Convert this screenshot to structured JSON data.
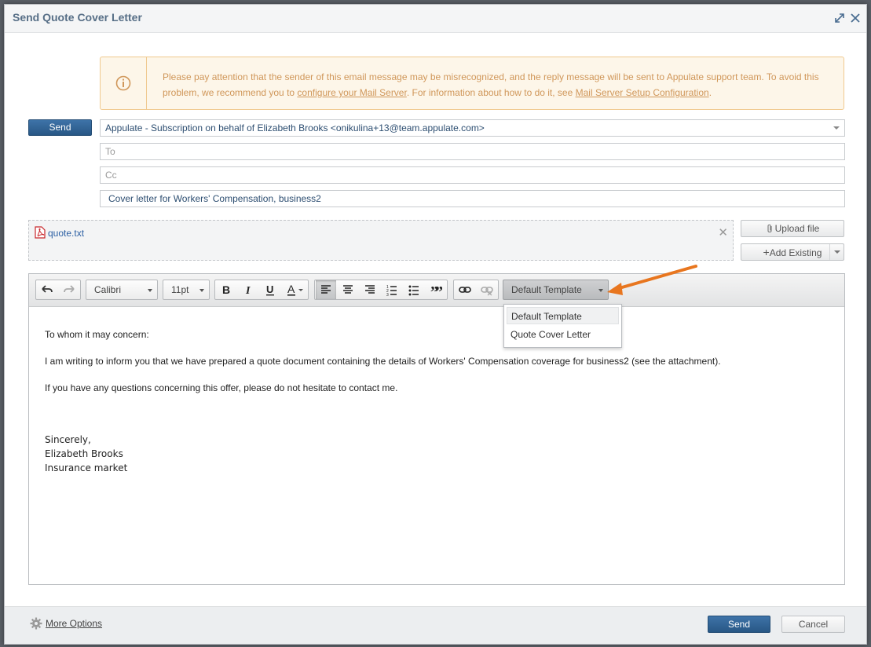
{
  "dialog": {
    "title": "Send Quote Cover Letter"
  },
  "warning": {
    "text_1": "Please pay attention that the sender of this email message may be misrecognized, and the reply message will be sent to Appulate support team. To avoid this problem, we recommend you to ",
    "link_1": "configure your Mail Server",
    "text_2": ". For information about how to do it, see ",
    "link_2": "Mail Server Setup Configuration",
    "text_3": "."
  },
  "compose": {
    "send_label": "Send",
    "from_value": "Appulate - Subscription on behalf of Elizabeth Brooks <onikulina+13@team.appulate.com>",
    "to_placeholder": "To",
    "cc_placeholder": "Cc",
    "subject_value": "Cover letter for Workers' Compensation, business2"
  },
  "attachments": {
    "files": [
      "quote.txt"
    ],
    "upload_label": "Upload file",
    "add_existing_label": "Add Existing"
  },
  "toolbar": {
    "font": "Calibri",
    "size": "11pt",
    "template": "Default Template",
    "template_options": [
      "Default Template",
      "Quote Cover Letter"
    ]
  },
  "body": {
    "greeting": "To whom it may concern:",
    "paragraph_1": "I am writing to inform you that we have prepared a quote document containing the details of Workers' Compensation coverage for business2 (see the attachment).",
    "paragraph_2": "If you have any questions concerning this offer, please do not hesitate to contact me.",
    "closing": "Sincerely,",
    "name": "Elizabeth Brooks",
    "company": "Insurance market"
  },
  "footer": {
    "more_options_label": "More Options",
    "send_label": "Send",
    "cancel_label": "Cancel"
  },
  "colors": {
    "accent": "#2f6295",
    "warning_border": "#f0c98e",
    "warning_text": "#d0975a",
    "arrow": "#e8761f"
  }
}
